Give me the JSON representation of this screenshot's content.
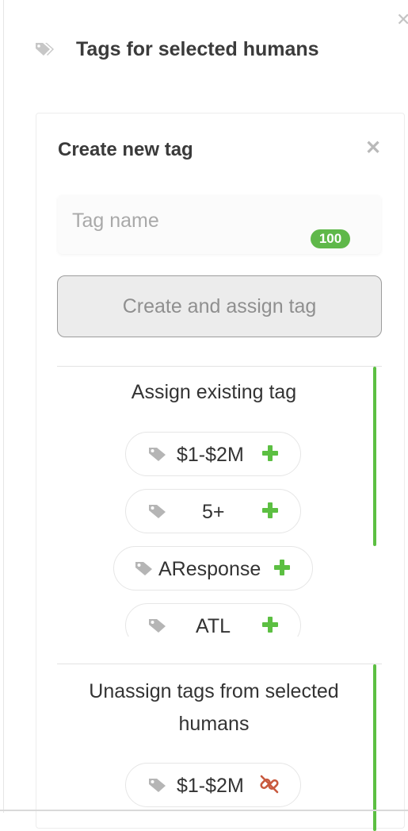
{
  "header": {
    "title": "Tags for selected humans",
    "icon": "tags-icon",
    "close_icon": "close-icon"
  },
  "create_tag": {
    "title": "Create new tag",
    "close_icon": "close-icon",
    "input_placeholder": "Tag name",
    "input_value": "",
    "char_counter": "100",
    "button_label": "Create and assign tag"
  },
  "assign": {
    "heading": "Assign existing tag",
    "tags": [
      {
        "label": "$1-$2M",
        "icon": "tag-icon",
        "action_icon": "plus-icon"
      },
      {
        "label": "5+",
        "icon": "tag-icon",
        "action_icon": "plus-icon"
      },
      {
        "label": "AResponse",
        "icon": "tag-icon",
        "action_icon": "plus-icon"
      },
      {
        "label": "ATL",
        "icon": "tag-icon",
        "action_icon": "plus-icon"
      }
    ]
  },
  "unassign": {
    "heading_line1": "Unassign tags from selected",
    "heading_line2": "humans",
    "tags": [
      {
        "label": "$1-$2M",
        "icon": "tag-icon",
        "action_icon": "unlink-icon"
      }
    ]
  },
  "colors": {
    "accent_green": "#5cbf42",
    "counter_green": "#5fb84a",
    "unlink_red": "#c8593e",
    "icon_gray": "#b5b5b5"
  }
}
